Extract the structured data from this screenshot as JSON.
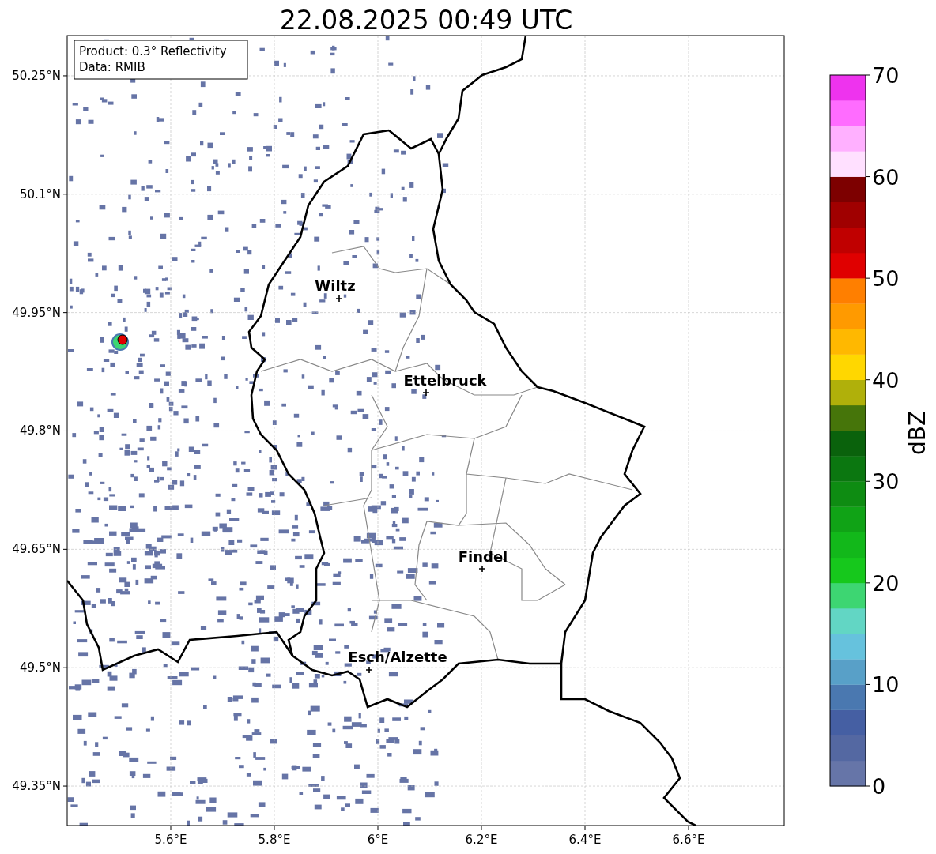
{
  "title": "22.08.2025 00:49 UTC",
  "info_box": {
    "lines": [
      "Product: 0.3° Reflectivity",
      "Data: RMIB"
    ]
  },
  "map": {
    "x_ticks": [
      "5.6°E",
      "5.8°E",
      "6°E",
      "6.2°E",
      "6.4°E",
      "6.6°E"
    ],
    "y_ticks": [
      "50.25°N",
      "50.1°N",
      "49.95°N",
      "49.8°N",
      "49.65°N",
      "49.5°N",
      "49.35°N"
    ],
    "cities": [
      {
        "label": "Wiltz"
      },
      {
        "label": "Ettelbruck"
      },
      {
        "label": "Findel"
      },
      {
        "label": "Esch/Alzette"
      }
    ]
  },
  "colorbar": {
    "label": "dBZ",
    "ticks": [
      "70",
      "60",
      "50",
      "40",
      "30",
      "20",
      "10",
      "0"
    ],
    "segments": [
      {
        "color": "#6675a8"
      },
      {
        "color": "#5468a2"
      },
      {
        "color": "#455fa3"
      },
      {
        "color": "#4a78b0"
      },
      {
        "color": "#58a0c8"
      },
      {
        "color": "#66c2dd"
      },
      {
        "color": "#62d6c4"
      },
      {
        "color": "#3dd672"
      },
      {
        "color": "#16c81c"
      },
      {
        "color": "#12b81a"
      },
      {
        "color": "#10a316"
      },
      {
        "color": "#0e8c12"
      },
      {
        "color": "#0b7710"
      },
      {
        "color": "#0a620c"
      },
      {
        "color": "#46750a"
      },
      {
        "color": "#b0b00a"
      },
      {
        "color": "#ffd700"
      },
      {
        "color": "#ffb800"
      },
      {
        "color": "#ff9a00"
      },
      {
        "color": "#ff7f00"
      },
      {
        "color": "#e00000"
      },
      {
        "color": "#c00000"
      },
      {
        "color": "#a00000"
      },
      {
        "color": "#7d0000"
      },
      {
        "color": "#ffe0ff"
      },
      {
        "color": "#ffb0ff"
      },
      {
        "color": "#ff6cff"
      },
      {
        "color": "#ee33ee"
      }
    ]
  }
}
